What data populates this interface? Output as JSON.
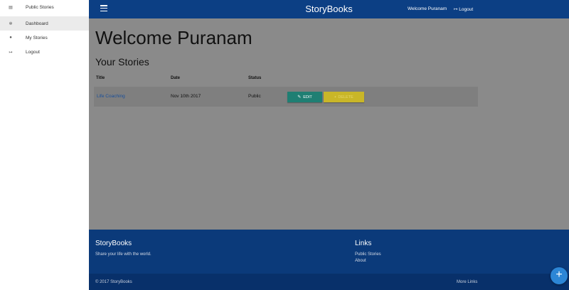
{
  "app": {
    "brand": "StoryBooks"
  },
  "topbar": {
    "welcome": "Welcome Puranam",
    "logout": "Logout"
  },
  "sidebar": {
    "items": [
      {
        "label": "Public Stories",
        "icon": "book-icon"
      },
      {
        "label": "Dashboard",
        "icon": "gear-icon"
      },
      {
        "label": "My Stories",
        "icon": "user-icon"
      },
      {
        "label": "Logout",
        "icon": "sign-out-icon"
      }
    ]
  },
  "main": {
    "title": "Welcome Puranam",
    "section": "Your Stories",
    "table": {
      "headers": [
        "Title",
        "Date",
        "Status"
      ],
      "rows": [
        {
          "title": "Life Coaching",
          "date": "Nov 10th 2017",
          "status": "Public",
          "edit": "EDIT",
          "delete": "DELETE"
        }
      ]
    }
  },
  "footer": {
    "brand": "StoryBooks",
    "tagline": "Share your life with the world.",
    "links_title": "Links",
    "links": [
      "Public Stories",
      "About"
    ],
    "copyright": "© 2017 StoryBooks",
    "more": "More Links"
  },
  "colors": {
    "primary": "#0c3f84",
    "edit": "#1f7f73",
    "delete": "#c9b628",
    "fab": "#2c86d6"
  }
}
